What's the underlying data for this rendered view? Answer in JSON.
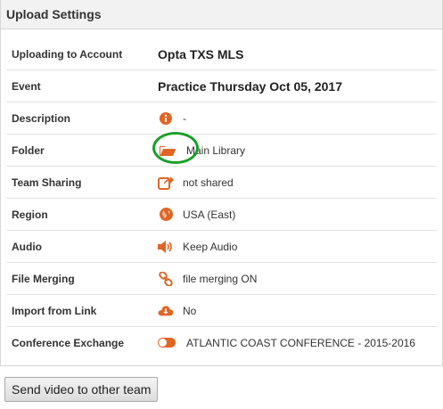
{
  "header": {
    "title": "Upload Settings"
  },
  "colors": {
    "accent": "#e06524",
    "highlight": "#1aa02a"
  },
  "rows": [
    {
      "label": "Uploading to Account",
      "value": "Opta TXS MLS",
      "icon": ""
    },
    {
      "label": "Event",
      "value": "Practice Thursday Oct 05, 2017",
      "icon": ""
    },
    {
      "label": "Description",
      "value": "-",
      "icon": "info-icon"
    },
    {
      "label": "Folder",
      "value": "Main Library",
      "icon": "folder-open-icon"
    },
    {
      "label": "Team Sharing",
      "value": "not shared",
      "icon": "share-icon"
    },
    {
      "label": "Region",
      "value": "USA (East)",
      "icon": "globe-icon"
    },
    {
      "label": "Audio",
      "value": "Keep Audio",
      "icon": "volume-icon"
    },
    {
      "label": "File Merging",
      "value": "file merging ON",
      "icon": "link-icon"
    },
    {
      "label": "Import from Link",
      "value": "No",
      "icon": "cloud-download-icon"
    },
    {
      "label": "Conference Exchange",
      "value": "ATLANTIC COAST CONFERENCE - 2015-2016",
      "icon": "toggle-icon"
    }
  ],
  "actions": {
    "send_video_label": "Send video to other team"
  }
}
